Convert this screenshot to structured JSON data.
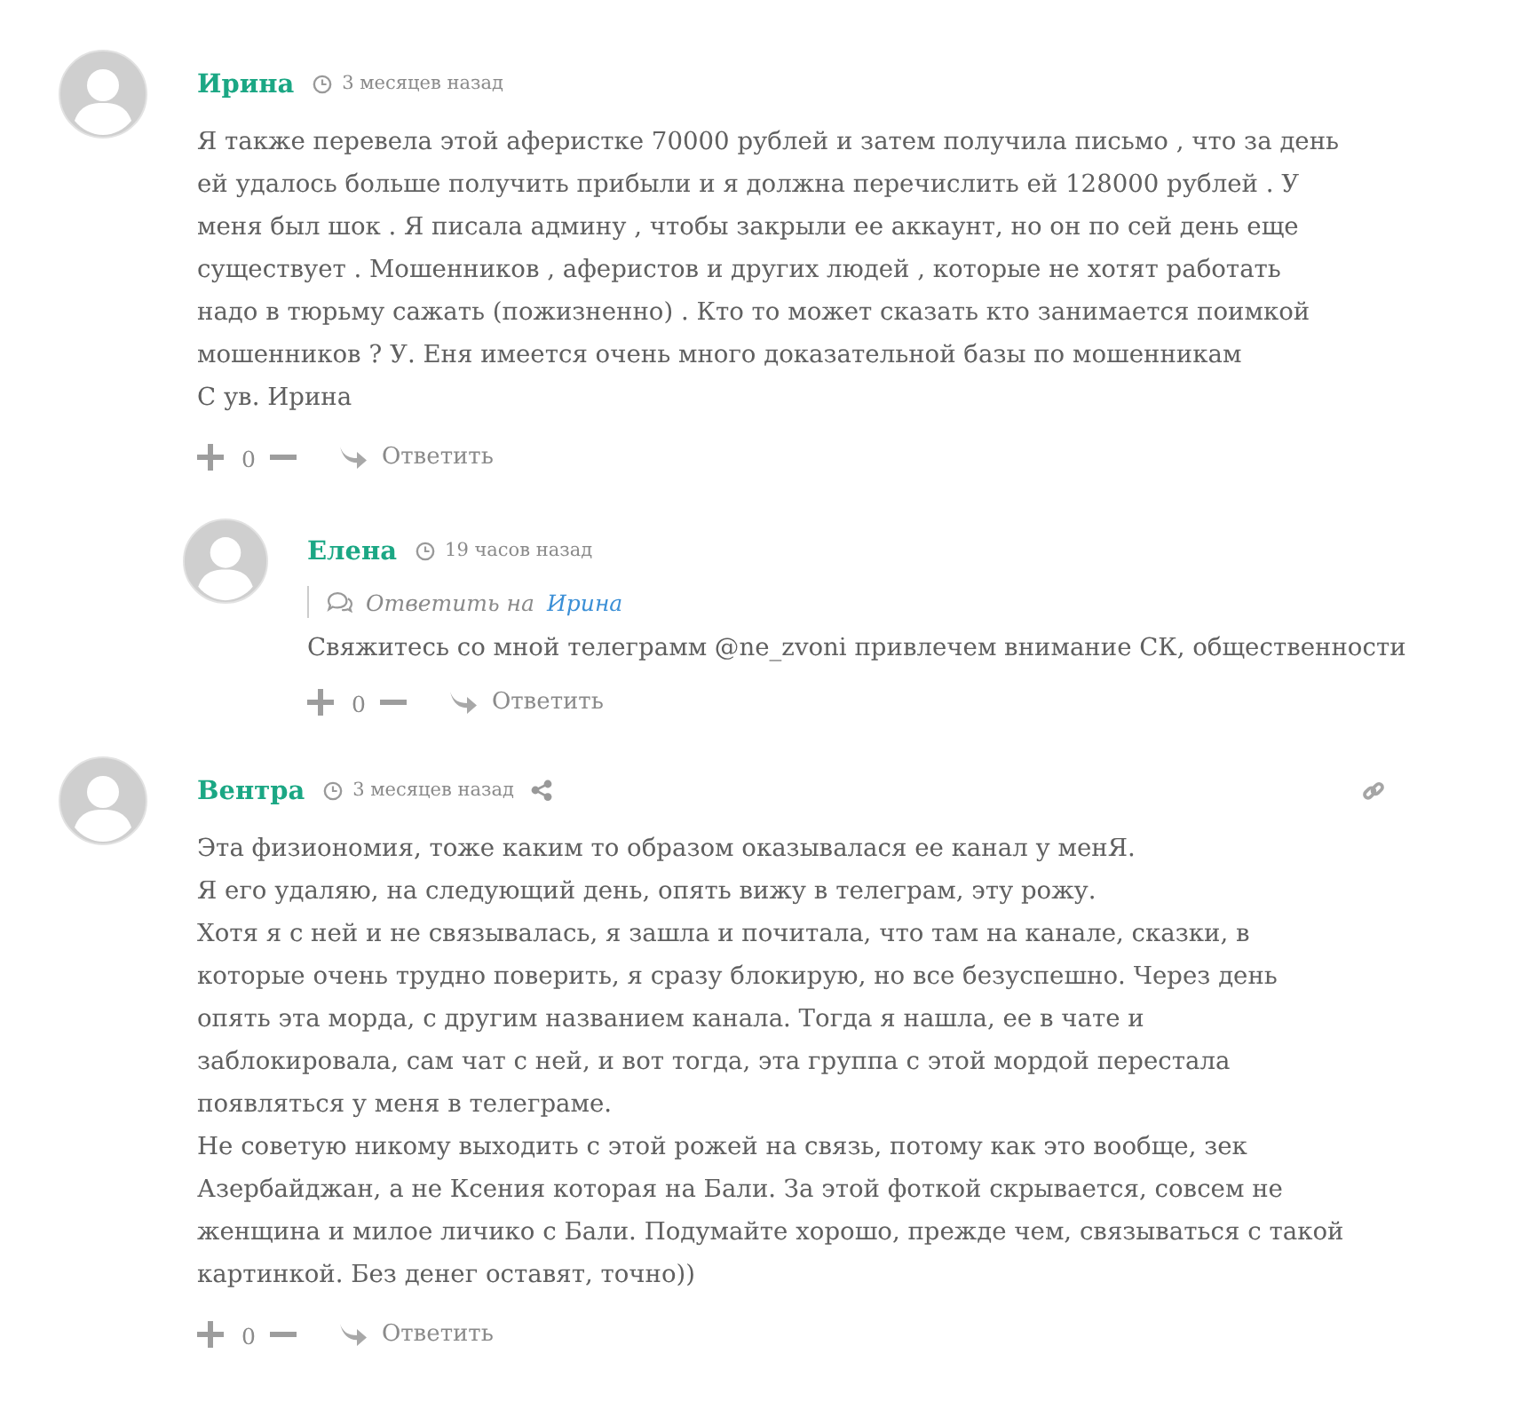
{
  "comments": [
    {
      "author": "Ирина",
      "time": "3 месяцев назад",
      "lines": [
        "Я также перевела этой аферистке 70000 рублей и затем получила письмо , что за день",
        "ей удалось больше получить прибыли и я должна перечислить ей 128000 рублей . У",
        "меня был шок . Я писала админу , чтобы закрыли ее аккаунт, но он по сей день еще",
        "существует . Мошенников , аферистов и других людей , которые не хотят работать",
        "надо в тюрьму сажать (пожизненно) . Кто то может сказать кто занимается поимкой",
        "мошенников ? У. Еня имеется очень много доказательной базы по мошенникам",
        "С ув. Ирина"
      ],
      "votes": "0",
      "reply_label": "Ответить",
      "children": [
        {
          "author": "Елена",
          "time": "19 часов назад",
          "reply_to": {
            "label": "Ответить на",
            "name": "Ирина"
          },
          "lines": [
            "Свяжитесь со мной телеграмм @ne_zvoni привлечем внимание СК, общественности"
          ],
          "votes": "0",
          "reply_label": "Ответить"
        }
      ]
    },
    {
      "author": "Вентра",
      "time": "3 месяцев назад",
      "share": true,
      "permalink": true,
      "lines": [
        "Эта физиономия, тоже каким то образом оказывалася ее канал у менЯ.",
        "Я его удаляю, на следующий день, опять вижу в телеграм, эту рожу.",
        "Хотя я с ней и не связывалась, я зашла и почитала, что там на канале, сказки, в",
        "которые очень трудно поверить, я сразу блокирую, но все безуспешно. Через день",
        "опять эта морда, с другим названием канала. Тогда я нашла, ее в чате и",
        "заблокировала, сам чат с ней, и вот тогда, эта группа с этой мордой перестала",
        "появляться у меня в телеграме.",
        "Не советую никому выходить с этой рожей на связь, потому как это вообще, зек",
        "Азербайджан, а не Ксения которая на Бали. За этой фоткой скрывается, совсем не",
        "женщина и милое личико с Бали. Подумайте хорошо, прежде чем, связываться с такой",
        "картинкой. Без денег оставят, точно))"
      ],
      "votes": "0",
      "reply_label": "Ответить"
    }
  ]
}
